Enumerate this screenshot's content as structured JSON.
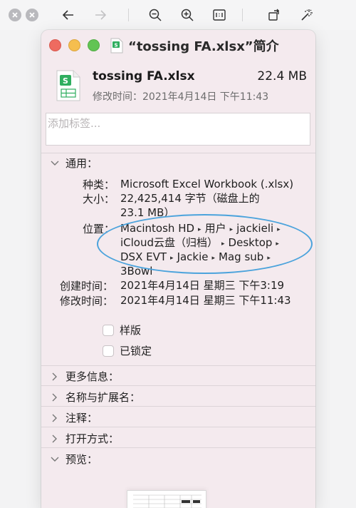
{
  "window": {
    "title": "“tossing FA.xlsx”简介"
  },
  "file": {
    "name": "tossing FA.xlsx",
    "size": "22.4 MB",
    "modified_line": "修改时间：2021年4月14日 下午11:43"
  },
  "tags": {
    "placeholder": "添加标签..."
  },
  "general": {
    "header": "通用：",
    "kind_label": "种类：",
    "kind_value": "Microsoft Excel Workbook (.xlsx)",
    "size_label": "大小：",
    "size_value_line1": "22,425,414 字节（磁盘上的",
    "size_value_line2": "23.1 MB）",
    "where_label": "位置：",
    "where_line1_parts": [
      "Macintosh HD",
      "用户",
      "jackieli"
    ],
    "where_line2_parts": [
      "iCloud云盘（归档）",
      "Desktop"
    ],
    "where_line3_parts": [
      "DSX EVT",
      "Jackie",
      "Mag sub"
    ],
    "where_line4": "3Bowl",
    "created_label": "创建时间：",
    "created_value": "2021年4月14日 星期三 下午3:19",
    "modified_label": "修改时间：",
    "modified_value": "2021年4月14日 星期三 下午11:43",
    "stationery_label": "样版",
    "locked_label": "已锁定"
  },
  "sections": {
    "more_info": "更多信息：",
    "name_ext": "名称与扩展名：",
    "comments": "注释：",
    "open_with": "打开方式：",
    "preview": "预览："
  },
  "colors": {
    "window_bg": "#f4eaee",
    "annotation_oval": "#4ba3dc",
    "excel_green": "#2fae5f"
  },
  "icons": {
    "toolbar": [
      "close-circle-icon",
      "minimize-circle-icon",
      "back-arrow-icon",
      "forward-arrow-icon",
      "zoom-out-icon",
      "zoom-in-icon",
      "actual-size-icon",
      "rotate-icon",
      "magic-wand-icon"
    ]
  }
}
